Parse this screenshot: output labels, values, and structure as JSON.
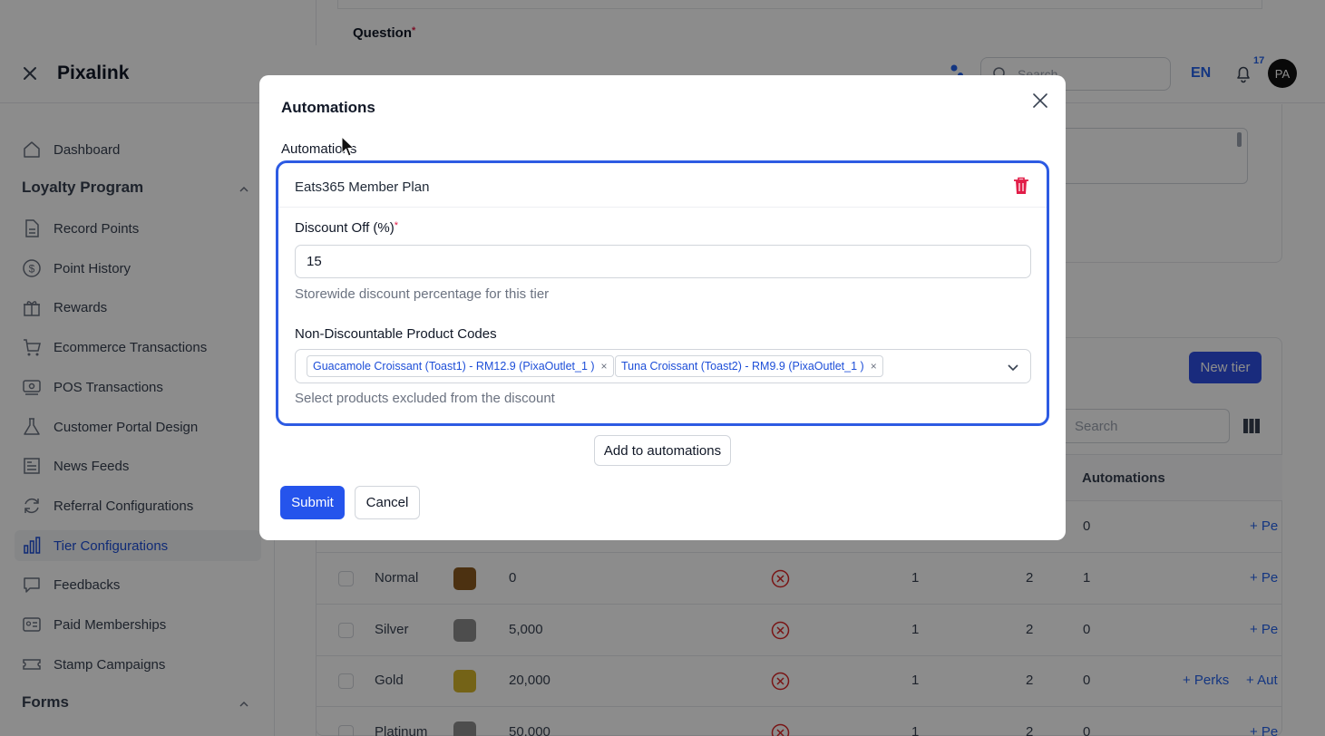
{
  "page_top": {
    "question_label": "Question"
  },
  "topbar": {
    "brand": "Pixalink",
    "search_placeholder": "Search",
    "language": "EN",
    "notification_count": "17",
    "avatar_initials": "PA"
  },
  "sidebar": {
    "dashboard": "Dashboard",
    "group_loyalty": "Loyalty Program",
    "items": [
      {
        "label": "Record Points",
        "icon": "document-icon"
      },
      {
        "label": "Point History",
        "icon": "dollar-icon"
      },
      {
        "label": "Rewards",
        "icon": "gift-icon"
      },
      {
        "label": "Ecommerce Transactions",
        "icon": "cart-icon"
      },
      {
        "label": "POS Transactions",
        "icon": "pos-icon"
      },
      {
        "label": "Customer Portal Design",
        "icon": "flask-icon"
      },
      {
        "label": "News Feeds",
        "icon": "newspaper-icon"
      },
      {
        "label": "Referral Configurations",
        "icon": "refresh-icon"
      },
      {
        "label": "Tier Configurations",
        "icon": "bar-chart-icon",
        "active": true
      },
      {
        "label": "Feedbacks",
        "icon": "chat-icon"
      },
      {
        "label": "Paid Memberships",
        "icon": "id-card-icon"
      },
      {
        "label": "Stamp Campaigns",
        "icon": "ticket-icon"
      }
    ],
    "group_forms": "Forms"
  },
  "tiers": {
    "new_tier_label": "New tier",
    "search_placeholder": "Search",
    "header_automations": "Automations",
    "first_row": {
      "c3": "0",
      "link": "+ Pe"
    },
    "rows": [
      {
        "name": "Normal",
        "color": "#8a5a1f",
        "points": "0",
        "c1": "1",
        "c2": "2",
        "c3": "1",
        "links": [
          "+ Pe"
        ]
      },
      {
        "name": "Silver",
        "color": "#8c8c8c",
        "points": "5,000",
        "c1": "1",
        "c2": "2",
        "c3": "0",
        "links": [
          "+ Pe"
        ]
      },
      {
        "name": "Gold",
        "color": "#d4b42a",
        "points": "20,000",
        "c1": "1",
        "c2": "2",
        "c3": "0",
        "links": [
          "+ Perks",
          "+ Aut"
        ]
      },
      {
        "name": "Platinum",
        "color": "#8c8c8c",
        "points": "50,000",
        "c1": "1",
        "c2": "2",
        "c3": "0",
        "links": [
          "+ Pe"
        ]
      }
    ]
  },
  "modal": {
    "title": "Automations",
    "section_label": "Automations",
    "automation": {
      "name": "Eats365 Member Plan",
      "discount_label": "Discount Off (%)",
      "discount_value": "15",
      "discount_help": "Storewide discount percentage for this tier",
      "codes_label": "Non-Discountable Product Codes",
      "codes_selected": [
        "Guacamole Croissant (Toast1) - RM12.9 (PixaOutlet_1 )",
        "Tuna Croissant (Toast2) - RM9.9 (PixaOutlet_1 )"
      ],
      "codes_help": "Select products excluded from the discount"
    },
    "add_button": "Add to automations",
    "submit_button": "Submit",
    "cancel_button": "Cancel"
  },
  "colors": {
    "primary": "#2554ec",
    "focus_border": "#2d5be3",
    "danger": "#e11d48",
    "overlay": "rgba(0,0,0,0.45)"
  }
}
